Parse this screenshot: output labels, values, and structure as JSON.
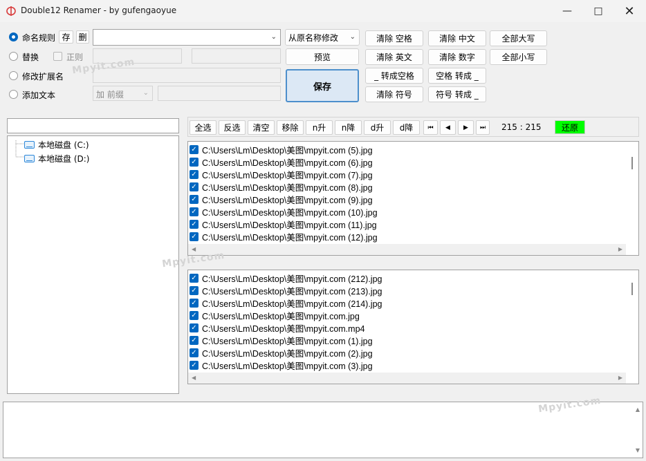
{
  "window": {
    "title": "Double12 Renamer - by gufengaoyue"
  },
  "options": {
    "rule_label": "命名规则",
    "save_rule": "存",
    "delete_rule": "删",
    "replace_label": "替换",
    "regex_label": "正则",
    "ext_label": "修改扩展名",
    "add_text_label": "添加文本",
    "source_mode": "从原名称修改",
    "add_position": "加 前缀"
  },
  "actions": {
    "preview": "预览",
    "save": "保存",
    "clear_space": "清除 空格",
    "clear_english": "清除 英文",
    "underscore_to_space": "_ 转成空格",
    "clear_symbol": "清除 符号",
    "clear_chinese": "清除 中文",
    "clear_digits": "清除 数字",
    "space_to_underscore": "空格 转成 _",
    "symbol_to_underscore": "符号 转成 _",
    "all_upper": "全部大写",
    "all_lower": "全部小写"
  },
  "toolbar": {
    "select_all": "全选",
    "invert": "反选",
    "clear": "清空",
    "remove": "移除",
    "n_asc": "n升",
    "n_desc": "n降",
    "d_asc": "d升",
    "d_desc": "d降",
    "first": "⏮",
    "prev": "◀",
    "next": "▶",
    "last": "⏭",
    "count": "215 : 215",
    "restore": "还原"
  },
  "tree": {
    "items": [
      "本地磁盘 (C:)",
      "本地磁盘 (D:)"
    ]
  },
  "list_top": [
    "C:\\Users\\Lm\\Desktop\\美图\\mpyit.com (5).jpg",
    "C:\\Users\\Lm\\Desktop\\美图\\mpyit.com (6).jpg",
    "C:\\Users\\Lm\\Desktop\\美图\\mpyit.com (7).jpg",
    "C:\\Users\\Lm\\Desktop\\美图\\mpyit.com (8).jpg",
    "C:\\Users\\Lm\\Desktop\\美图\\mpyit.com (9).jpg",
    "C:\\Users\\Lm\\Desktop\\美图\\mpyit.com (10).jpg",
    "C:\\Users\\Lm\\Desktop\\美图\\mpyit.com (11).jpg",
    "C:\\Users\\Lm\\Desktop\\美图\\mpyit.com (12).jpg"
  ],
  "list_bottom": [
    "C:\\Users\\Lm\\Desktop\\美图\\mpyit.com (212).jpg",
    "C:\\Users\\Lm\\Desktop\\美图\\mpyit.com (213).jpg",
    "C:\\Users\\Lm\\Desktop\\美图\\mpyit.com (214).jpg",
    "C:\\Users\\Lm\\Desktop\\美图\\mpyit.com.jpg",
    "C:\\Users\\Lm\\Desktop\\美图\\mpyit.com.mp4",
    "C:\\Users\\Lm\\Desktop\\美图\\mpyit.com (1).jpg",
    "C:\\Users\\Lm\\Desktop\\美图\\mpyit.com (2).jpg",
    "C:\\Users\\Lm\\Desktop\\美图\\mpyit.com (3).jpg"
  ],
  "watermarks": [
    "Mpyit.com",
    "Mpyit.com",
    "Mpyit.com"
  ],
  "colors": {
    "accent": "#0067c0",
    "restore": "#00ff00",
    "save_button": "#dce8f5"
  }
}
